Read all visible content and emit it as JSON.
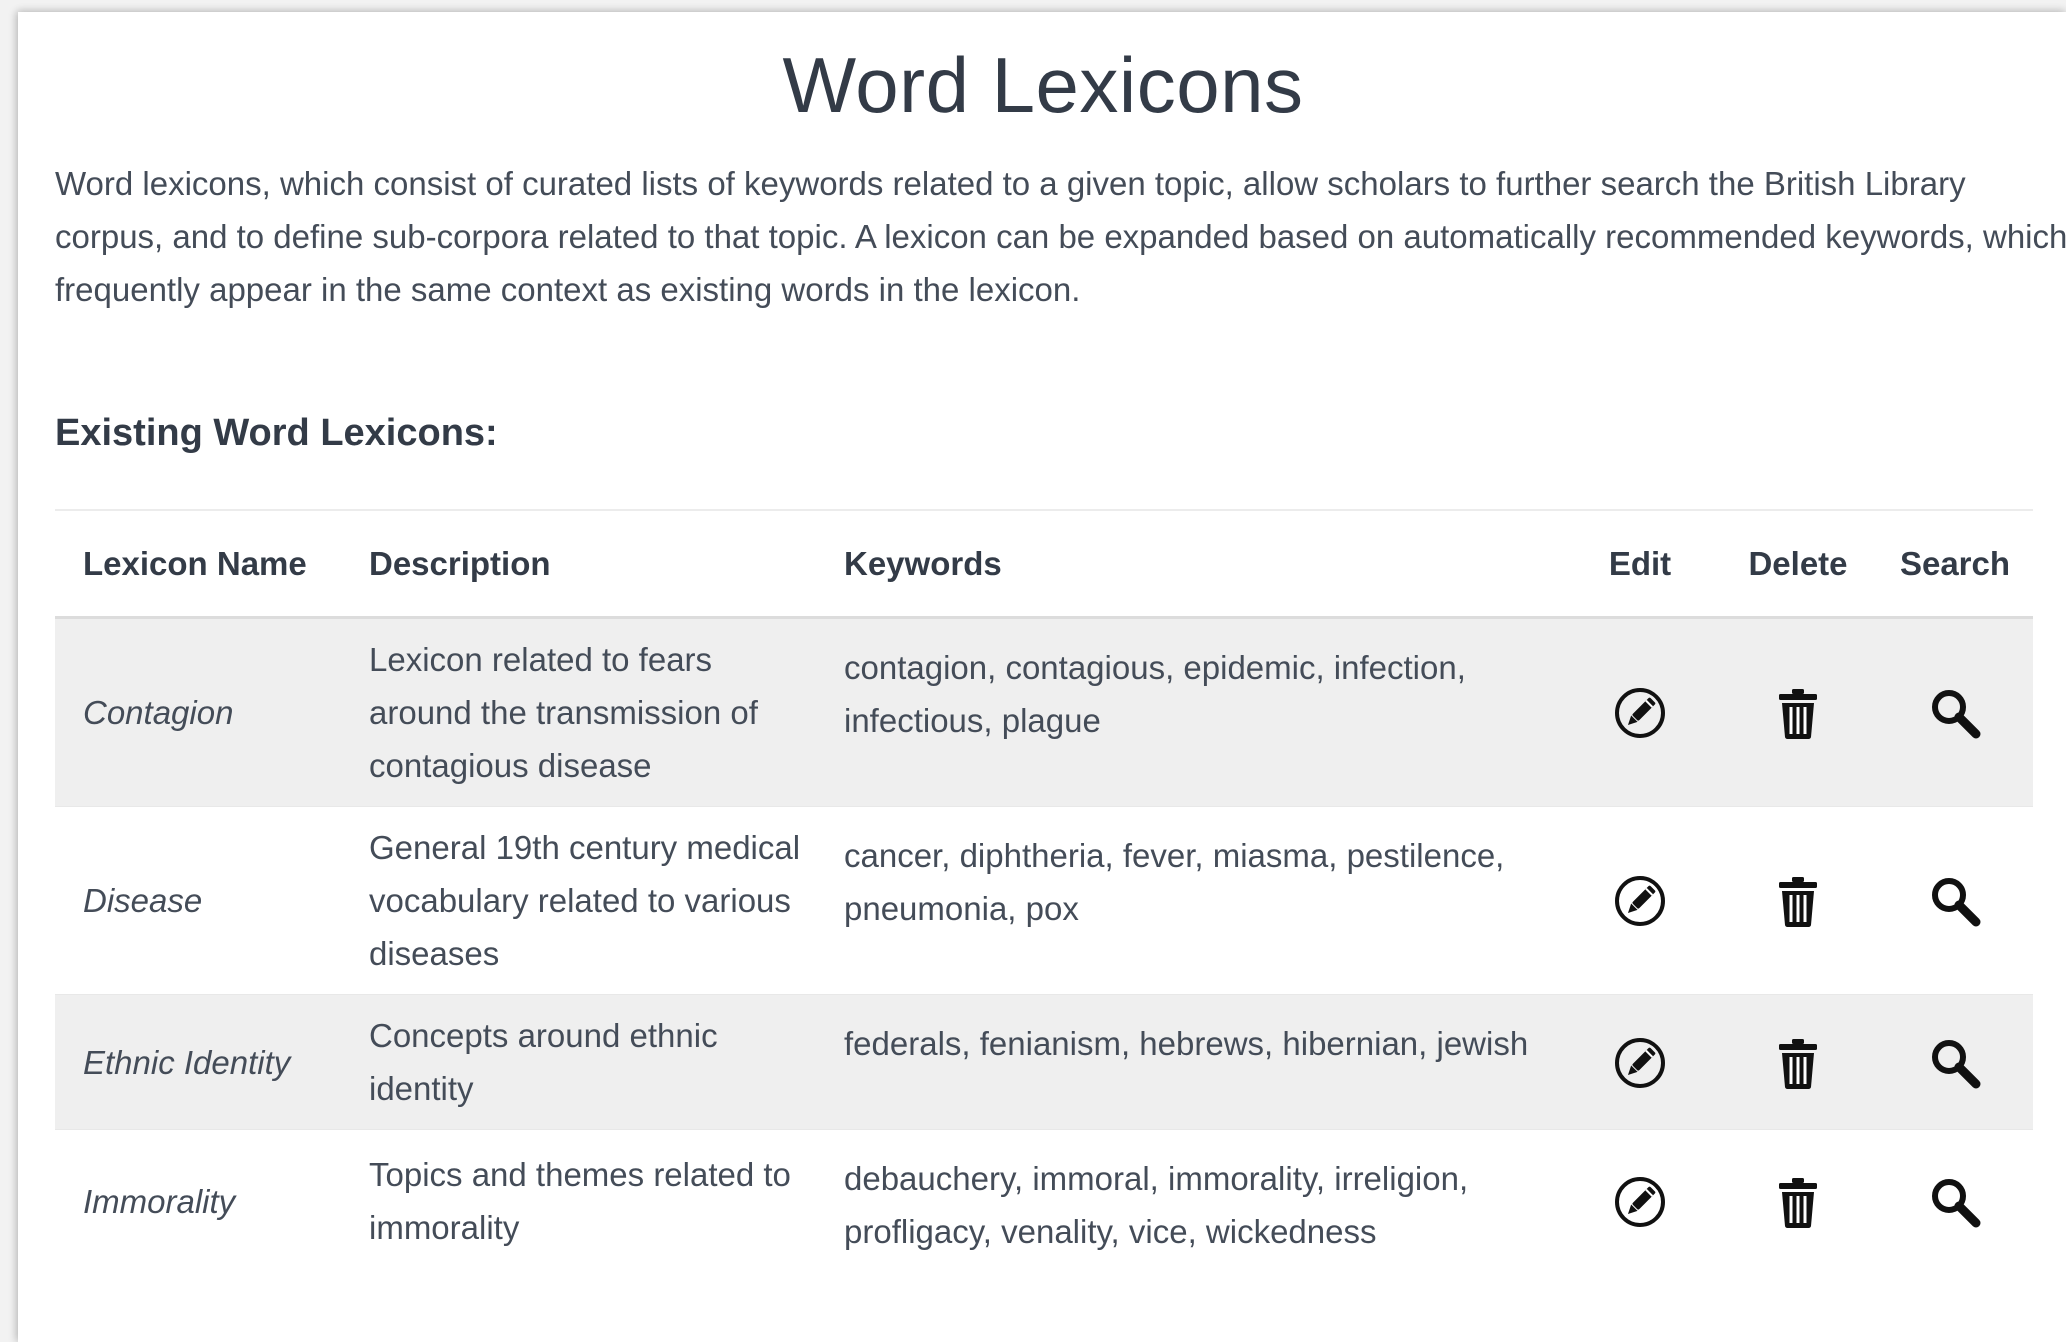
{
  "page": {
    "title": "Word Lexicons",
    "intro": "Word lexicons, which consist of curated lists of keywords related to a given topic, allow scholars to further search the British Library corpus, and to define sub-corpora related to that topic. A lexicon can be expanded based on automatically recommended keywords, which frequently appear in the same context as existing words in the lexicon.",
    "section_heading": "Existing Word Lexicons:"
  },
  "table": {
    "headers": {
      "name": "Lexicon Name",
      "description": "Description",
      "keywords": "Keywords",
      "edit": "Edit",
      "delete": "Delete",
      "search": "Search"
    },
    "rows": [
      {
        "name": "Contagion",
        "description": "Lexicon related to fears around the transmission of contagious disease",
        "keywords": "contagion, contagious, epidemic, infection, infectious, plague"
      },
      {
        "name": "Disease",
        "description": "General 19th century medical vocabulary related to various diseases",
        "keywords": "cancer, diphtheria, fever, miasma, pestilence, pneumonia, pox"
      },
      {
        "name": "Ethnic Identity",
        "description": "Concepts around ethnic identity",
        "keywords": "federals, fenianism, hebrews, hibernian, jewish"
      },
      {
        "name": "Immorality",
        "description": "Topics and themes related to immorality",
        "keywords": "debauchery, immoral, immorality, irreligion, profligacy, venality, vice, wickedness"
      }
    ]
  },
  "icons": {
    "edit": "edit-pencil-circle-icon",
    "delete": "trash-icon",
    "search": "magnifier-icon"
  },
  "colors": {
    "text": "#444c58",
    "heading": "#333b47",
    "row_stripe": "#efefef",
    "icon": "#111111"
  }
}
